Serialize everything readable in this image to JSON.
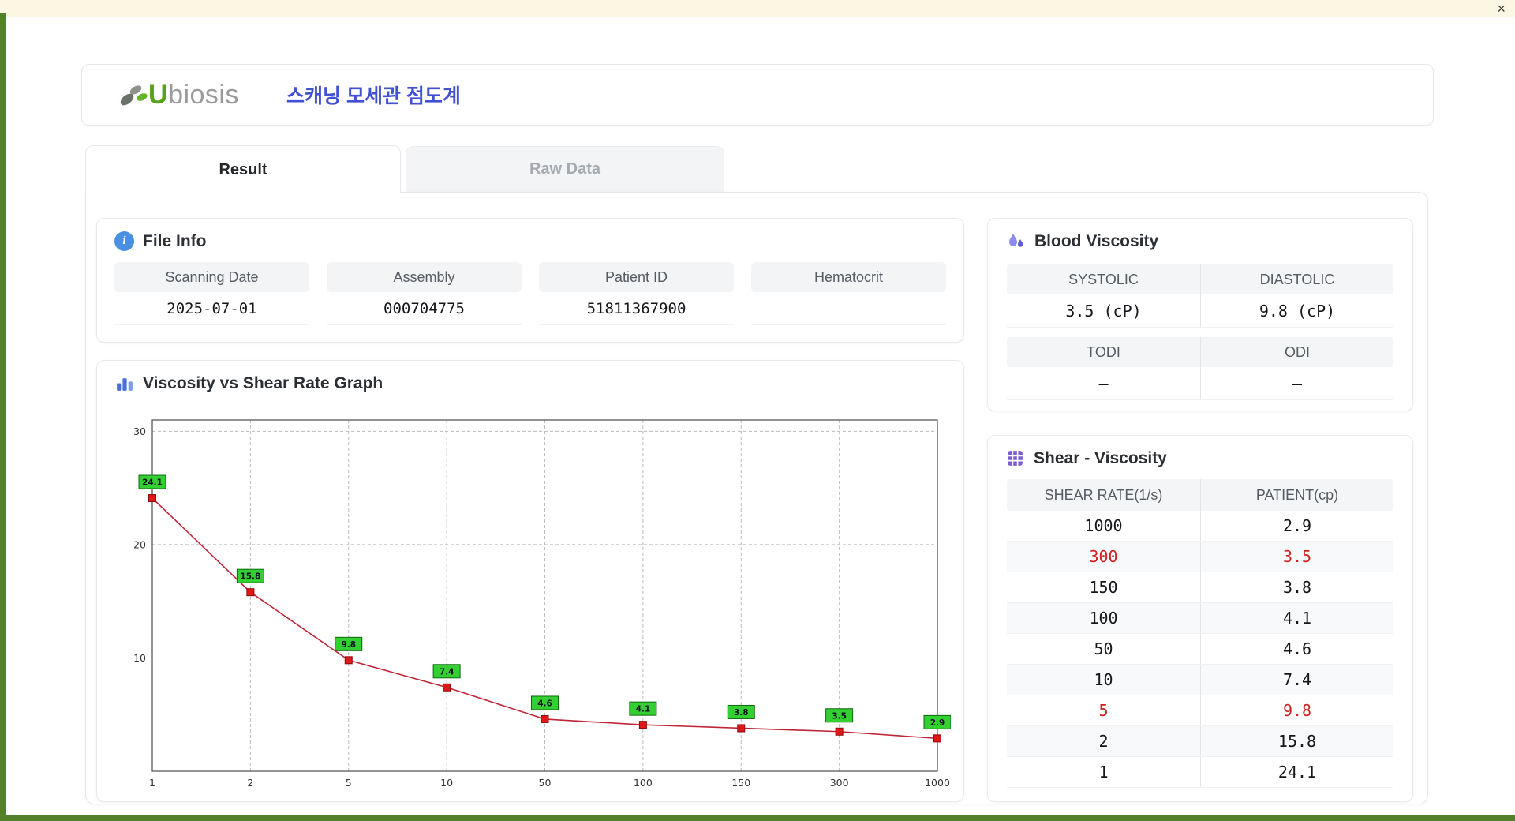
{
  "window": {
    "close_label": "×"
  },
  "icons": {
    "info_glyph": "i"
  },
  "header": {
    "logo_u": "U",
    "logo_rest": "biosis",
    "title": "스캐닝 모세관 점도계"
  },
  "tabs": [
    {
      "label": "Result",
      "active": true
    },
    {
      "label": "Raw Data",
      "active": false
    }
  ],
  "file_info": {
    "title": "File Info",
    "fields": [
      {
        "label": "Scanning Date",
        "value": "2025-07-01"
      },
      {
        "label": "Assembly",
        "value": "000704775"
      },
      {
        "label": "Patient ID",
        "value": "51811367900"
      },
      {
        "label": "Hematocrit",
        "value": ""
      }
    ]
  },
  "blood_viscosity": {
    "title": "Blood Viscosity",
    "rows": [
      {
        "labels": [
          "SYSTOLIC",
          "DIASTOLIC"
        ],
        "values": [
          "3.5 (cP)",
          "9.8 (cP)"
        ]
      },
      {
        "labels": [
          "TODI",
          "ODI"
        ],
        "values": [
          "–",
          "–"
        ]
      }
    ]
  },
  "chart_data": {
    "type": "line",
    "title": "Viscosity vs Shear Rate Graph",
    "xlabel": "",
    "ylabel": "",
    "x_labels": [
      "1",
      "2",
      "5",
      "10",
      "50",
      "100",
      "150",
      "300",
      "1000"
    ],
    "values": [
      24.1,
      15.8,
      9.8,
      7.4,
      4.6,
      4.1,
      3.8,
      3.5,
      2.9
    ],
    "ylim": [
      0,
      31
    ],
    "yticks": [
      10,
      20,
      30
    ],
    "grid": "dashed",
    "legend": "none",
    "line_color": "#c02536",
    "marker_color": "#e01818",
    "marker_edge": "#8c0a0a",
    "label_bg": "#33cf33",
    "label_edge": "#0c6a0c",
    "label_text_color": "#0c1020"
  },
  "shear_viscosity": {
    "title": "Shear - Viscosity",
    "columns": [
      "SHEAR RATE(1/s)",
      "PATIENT(cp)"
    ],
    "rows": [
      {
        "shear": "1000",
        "patient": "2.9",
        "highlight": false
      },
      {
        "shear": "300",
        "patient": "3.5",
        "highlight": true
      },
      {
        "shear": "150",
        "patient": "3.8",
        "highlight": false
      },
      {
        "shear": "100",
        "patient": "4.1",
        "highlight": false
      },
      {
        "shear": "50",
        "patient": "4.6",
        "highlight": false
      },
      {
        "shear": "10",
        "patient": "7.4",
        "highlight": false
      },
      {
        "shear": "5",
        "patient": "9.8",
        "highlight": true
      },
      {
        "shear": "2",
        "patient": "15.8",
        "highlight": false
      },
      {
        "shear": "1",
        "patient": "24.1",
        "highlight": false
      }
    ]
  }
}
